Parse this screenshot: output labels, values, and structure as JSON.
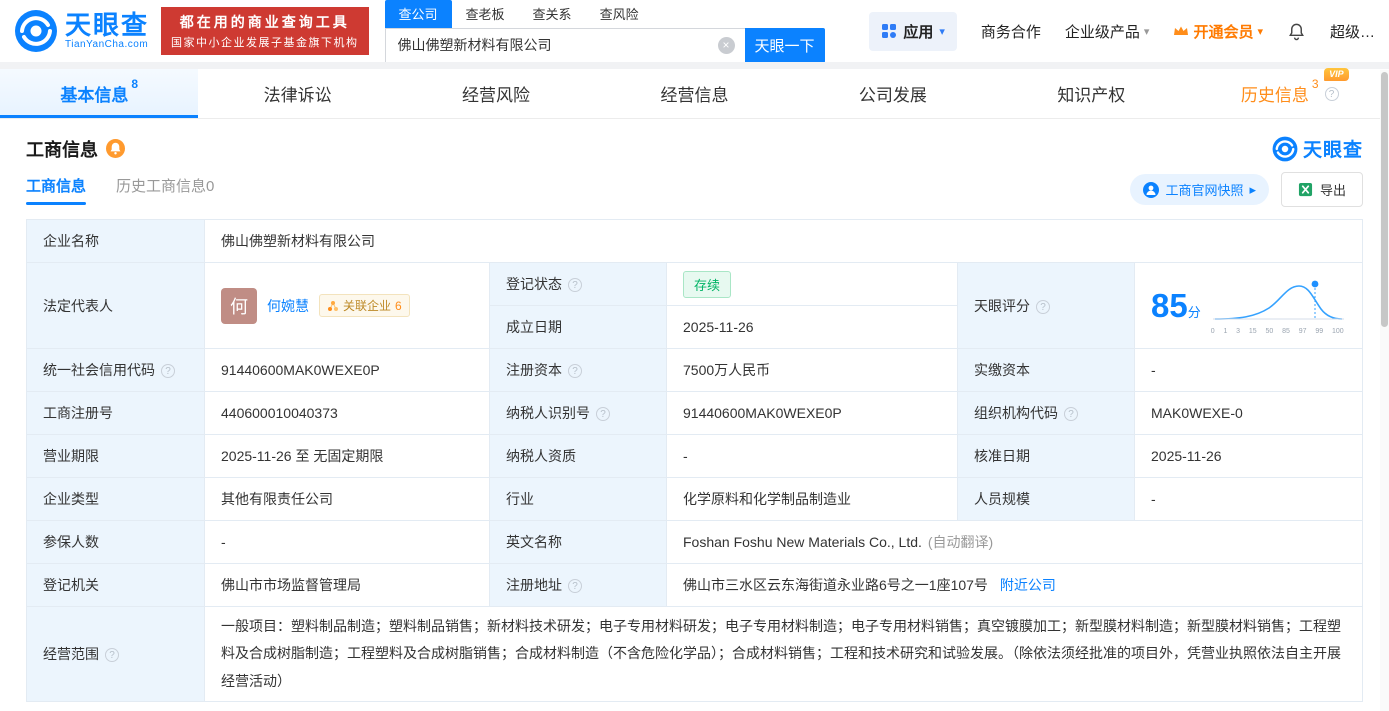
{
  "colors": {
    "brand_blue": "#0B82FF",
    "vip_orange": "#FF8D1A",
    "banner_red": "#CE3A32",
    "status_green": "#00B365"
  },
  "icons": {
    "help": "?",
    "caret_down": "▾",
    "arrow_right": "▸",
    "clear": "×"
  },
  "header": {
    "logo": {
      "name": "天眼查",
      "domain": "TianYanCha.com"
    },
    "banner": {
      "line1": "都在用的商业查询工具",
      "line2": "国家中小企业发展子基金旗下机构"
    },
    "search": {
      "tabs": [
        "查公司",
        "查老板",
        "查关系",
        "查风险"
      ],
      "value": "佛山佛塑新材料有限公司",
      "button": "天眼一下"
    },
    "nav": {
      "apps": "应用",
      "biz": "商务合作",
      "enterprise": "企业级产品",
      "vip": "开通会员",
      "super": "超级…"
    }
  },
  "tabs": [
    {
      "label": "基本信息",
      "count": "8"
    },
    {
      "label": "法律诉讼"
    },
    {
      "label": "经营风险"
    },
    {
      "label": "经营信息"
    },
    {
      "label": "公司发展"
    },
    {
      "label": "知识产权"
    },
    {
      "label": "历史信息",
      "count": "3",
      "vip": "VIP"
    }
  ],
  "section": {
    "title": "工商信息",
    "watermark": "天眼查",
    "subtabs": [
      "工商信息",
      "历史工商信息0"
    ],
    "snapshot": "工商官网快照",
    "export": "导出"
  },
  "table": {
    "company_name": {
      "label": "企业名称",
      "value": "佛山佛塑新材料有限公司"
    },
    "legal_rep": {
      "label": "法定代表人",
      "avatar": "何",
      "name": "何婉慧",
      "related_label": "关联企业",
      "related_count": "6"
    },
    "reg_status": {
      "label": "登记状态",
      "value": "存续"
    },
    "establish_date": {
      "label": "成立日期",
      "value": "2025-11-26"
    },
    "score": {
      "label": "天眼评分",
      "score": "85",
      "unit": "分",
      "ticks": [
        "0",
        "1",
        "3",
        "15",
        "50",
        "85",
        "97",
        "99",
        "100"
      ]
    },
    "credit_code": {
      "label": "统一社会信用代码",
      "value": "91440600MAK0WEXE0P"
    },
    "reg_capital": {
      "label": "注册资本",
      "value": "7500万人民币"
    },
    "paid_capital": {
      "label": "实缴资本",
      "value": "-"
    },
    "reg_number": {
      "label": "工商注册号",
      "value": "440600010040373"
    },
    "taxpayer_id": {
      "label": "纳税人识别号",
      "value": "91440600MAK0WEXE0P"
    },
    "org_code": {
      "label": "组织机构代码",
      "value": "MAK0WEXE-0"
    },
    "business_term": {
      "label": "营业期限",
      "value": "2025-11-26 至 无固定期限"
    },
    "taxpayer_quality": {
      "label": "纳税人资质",
      "value": "-"
    },
    "approval_date": {
      "label": "核准日期",
      "value": "2025-11-26"
    },
    "company_type": {
      "label": "企业类型",
      "value": "其他有限责任公司"
    },
    "industry": {
      "label": "行业",
      "value": "化学原料和化学制品制造业"
    },
    "staff_size": {
      "label": "人员规模",
      "value": "-"
    },
    "insured_count": {
      "label": "参保人数",
      "value": "-"
    },
    "english_name": {
      "label": "英文名称",
      "value": "Foshan Foshu New Materials Co., Ltd.",
      "note": "(自动翻译)"
    },
    "reg_authority": {
      "label": "登记机关",
      "value": "佛山市市场监督管理局"
    },
    "reg_address": {
      "label": "注册地址",
      "value": "佛山市三水区云东海街道永业路6号之一1座107号",
      "link": "附近公司"
    },
    "business_scope": {
      "label": "经营范围",
      "value": "一般项目：塑料制品制造；塑料制品销售；新材料技术研发；电子专用材料研发；电子专用材料制造；电子专用材料销售；真空镀膜加工；新型膜材料制造；新型膜材料销售；工程塑料及合成树脂制造；工程塑料及合成树脂销售；合成材料制造（不含危险化学品）；合成材料销售；工程和技术研究和试验发展。（除依法须经批准的项目外，凭营业执照依法自主开展经营活动）"
    }
  }
}
